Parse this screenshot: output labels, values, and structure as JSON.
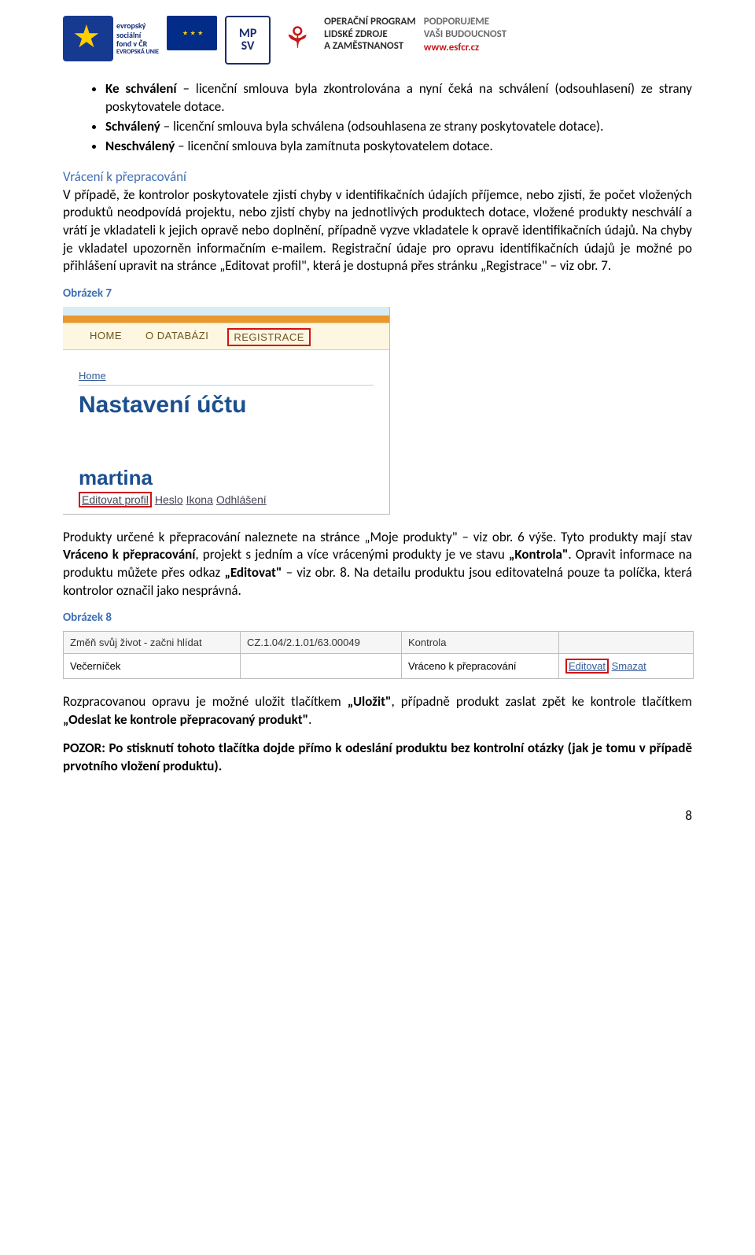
{
  "header": {
    "esf": {
      "l1": "evropský",
      "l2": "sociální",
      "l3": "fond v ČR",
      "l4": "EVROPSKÁ UNIE"
    },
    "mpsv": {
      "top": "MP",
      "bottom": "SV"
    },
    "op": "OPERAČNÍ PROGRAM\nLIDSKÉ ZDROJE\nA ZAMĚSTNANOST",
    "podp": {
      "l1": "PODPORUJEME",
      "l2": "VAŠI BUDOUCNOST",
      "l3": "www.esfcr.cz"
    }
  },
  "bullets": [
    {
      "label": "Ke schválení",
      "text": " – licenční smlouva byla zkontrolována a nyní čeká na schválení (odsouhlasení) ze strany poskytovatele dotace."
    },
    {
      "label": "Schválený",
      "text": " – licenční smlouva byla schválena (odsouhlasena ze strany poskytovatele dotace)."
    },
    {
      "label": "Neschválený",
      "text": " – licenční smlouva byla zamítnuta poskytovatelem dotace."
    }
  ],
  "section1": {
    "heading": "Vrácení k přepracování",
    "para": "V případě, že kontrolor poskytovatele zjistí chyby v identifikačních údajích příjemce, nebo zjistí, že počet vložených produktů neodpovídá projektu, nebo zjistí chyby na jednotlivých produktech dotace, vložené produkty neschválí a vrátí je vkladateli k jejich opravě nebo doplnění, případně vyzve vkladatele k opravě identifikačních údajů. Na chyby je vkladatel upozorněn informačním e-mailem. Registrační údaje pro opravu identifikačních údajů je možné po přihlášení upravit na stránce „Editovat profil\", která je dostupná přes stránku „Registrace\" – viz obr. 7."
  },
  "fig7": {
    "label": "Obrázek 7",
    "tabs": {
      "home": "HOME",
      "about": "O DATABÁZI",
      "reg": "REGISTRACE"
    },
    "crumb": "Home",
    "h1": "Nastavení účtu",
    "user": "martina",
    "sub": {
      "edit": "Editovat profil",
      "pass": "Heslo",
      "icon": "Ikona",
      "logout": "Odhlášení"
    }
  },
  "para2": "Produkty určené k přepracování naleznete na stránce „Moje produkty\" – viz obr. 6 výše. Tyto produkty mají stav Vráceno k přepracování, projekt s jedním a více vrácenými produkty je ve stavu „Kontrola\". Opravit informace na produktu můžete přes odkaz „Editovat\" – viz obr. 8. Na detailu produktu jsou editovatelná pouze ta políčka, která kontrolor označil jako nesprávná.",
  "para2_bold1": "Vráceno k přepracování",
  "para2_bold2": "Kontrola",
  "para2_bold3": "Editovat",
  "fig8": {
    "label": "Obrázek 8",
    "row1": {
      "c1": "Změň svůj život - začni hlídat",
      "c2": "CZ.1.04/2.1.01/63.00049",
      "c3": "Kontrola",
      "c4": ""
    },
    "row2": {
      "c1": "Večerníček",
      "c2": "",
      "c3": "Vráceno k přepracování",
      "edit": "Editovat",
      "del": "Smazat"
    }
  },
  "para3": "Rozpracovanou opravu je možné uložit tlačítkem „Uložit\", případně produkt zaslat zpět ke kontrole tlačítkem „Odeslat ke kontrole přepracovaný produkt\".",
  "para3_bold1": "Uložit",
  "para3_bold2": "Odeslat ke kontrole přepracovaný produkt",
  "pozor": "POZOR: Po stisknutí tohoto tlačítka dojde přímo k odeslání produktu bez kontrolní otázky (jak je tomu v případě prvotního vložení produktu).",
  "pagenum": "8"
}
